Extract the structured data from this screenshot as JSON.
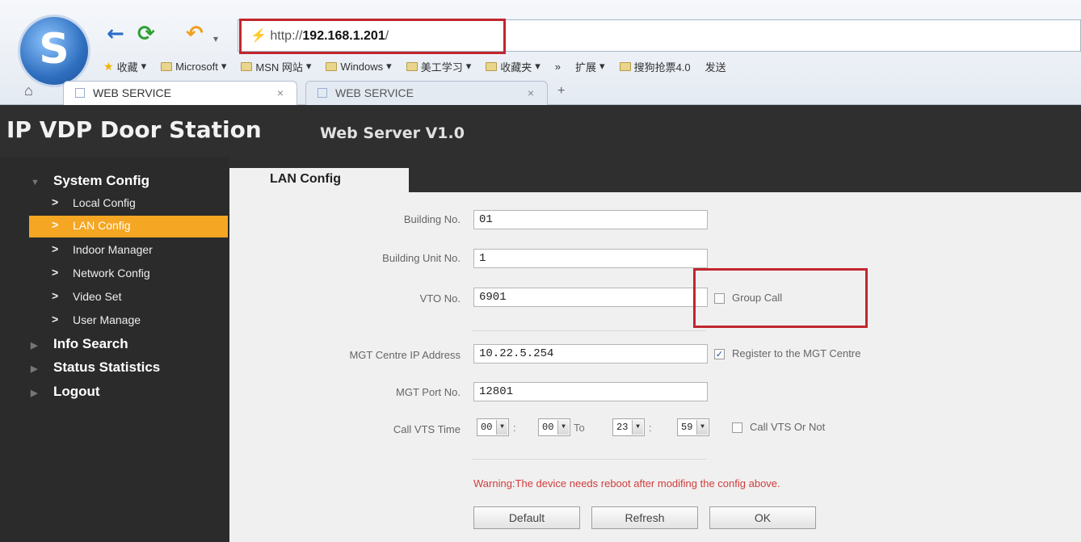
{
  "browser": {
    "address_prefix": "http://",
    "address_host": "192.168.1.201",
    "address_suffix": "/",
    "bookmarks": [
      "收藏",
      "Microsoft",
      "MSN 网站",
      "Windows",
      "美工学习",
      "收藏夹",
      "»",
      "扩展",
      "搜狗抢票4.0",
      "发送"
    ],
    "tabs": [
      {
        "label": "WEB SERVICE",
        "close": "×"
      },
      {
        "label": "WEB SERVICE",
        "close": "×"
      }
    ],
    "new_tab": "+"
  },
  "app": {
    "title": "IP VDP Door Station",
    "subtitle": "Web Server V1.0"
  },
  "sidebar": {
    "system_config": "System Config",
    "items": [
      {
        "label": "Local Config",
        "active": false
      },
      {
        "label": "LAN Config",
        "active": true
      },
      {
        "label": "Indoor Manager",
        "active": false
      },
      {
        "label": "Network Config",
        "active": false
      },
      {
        "label": "Video Set",
        "active": false
      },
      {
        "label": "User Manage",
        "active": false
      }
    ],
    "info_search": "Info Search",
    "status_statistics": "Status Statistics",
    "logout": "Logout"
  },
  "main": {
    "tab": "LAN Config",
    "building_no": {
      "label": "Building No.",
      "value": "01"
    },
    "building_unit_no": {
      "label": "Building Unit No.",
      "value": "1"
    },
    "vto_no": {
      "label": "VTO No.",
      "value": "6901"
    },
    "group_call": {
      "label": "Group Call",
      "checked": false
    },
    "mgt_ip": {
      "label": "MGT Centre IP Address",
      "value": "10.22.5.254"
    },
    "register_mgt": {
      "label": "Register to the MGT Centre",
      "checked": true
    },
    "mgt_port": {
      "label": "MGT Port No.",
      "value": "12801"
    },
    "call_vts_time": {
      "label": "Call VTS Time",
      "start_hour": "00",
      "start_min": "00",
      "to": "To",
      "end_hour": "23",
      "end_min": "59",
      "colon": ":"
    },
    "call_vts_or_not": {
      "label": "Call VTS Or Not",
      "checked": false
    },
    "warning": "Warning:The device needs reboot after modifing the config above.",
    "buttons": {
      "default": "Default",
      "refresh": "Refresh",
      "ok": "OK"
    }
  },
  "colors": {
    "accent": "#f5a623",
    "highlight": "#c2262e",
    "warning": "#d23c3c",
    "header_bg": "#2f2f2f"
  }
}
